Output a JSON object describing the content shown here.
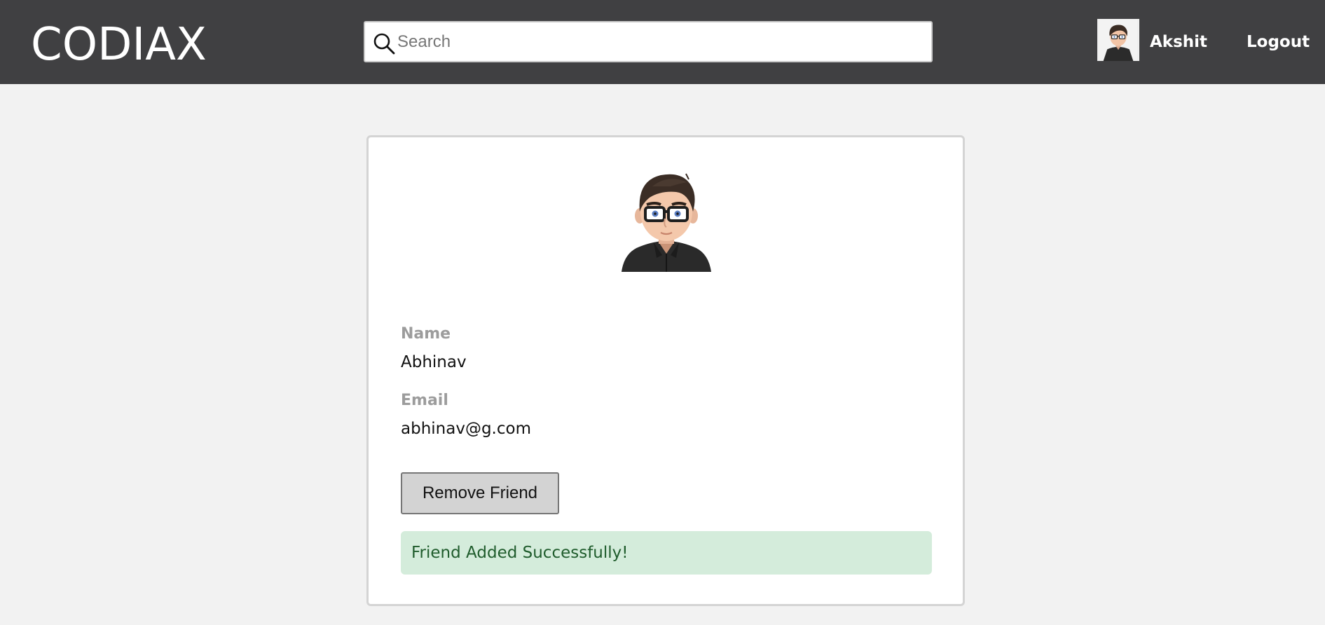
{
  "header": {
    "logo": "CODIAX",
    "search": {
      "placeholder": "Search",
      "value": ""
    },
    "user": {
      "name": "Akshit",
      "avatar_icon": "cartoon-avatar-icon"
    },
    "logout_label": "Logout"
  },
  "profile": {
    "avatar_icon": "cartoon-avatar-icon",
    "name_label": "Name",
    "name_value": "Abhinav",
    "email_label": "Email",
    "email_value": "abhinav@g.com",
    "remove_button_label": "Remove Friend",
    "alert_message": "Friend Added Successfully!"
  },
  "colors": {
    "navbar_bg": "#404042",
    "page_bg": "#f2f2f2",
    "alert_bg": "#d4ecdb",
    "alert_text": "#1f5c2c",
    "button_bg": "#d3d3d3",
    "label_text": "#9c9c9c"
  }
}
